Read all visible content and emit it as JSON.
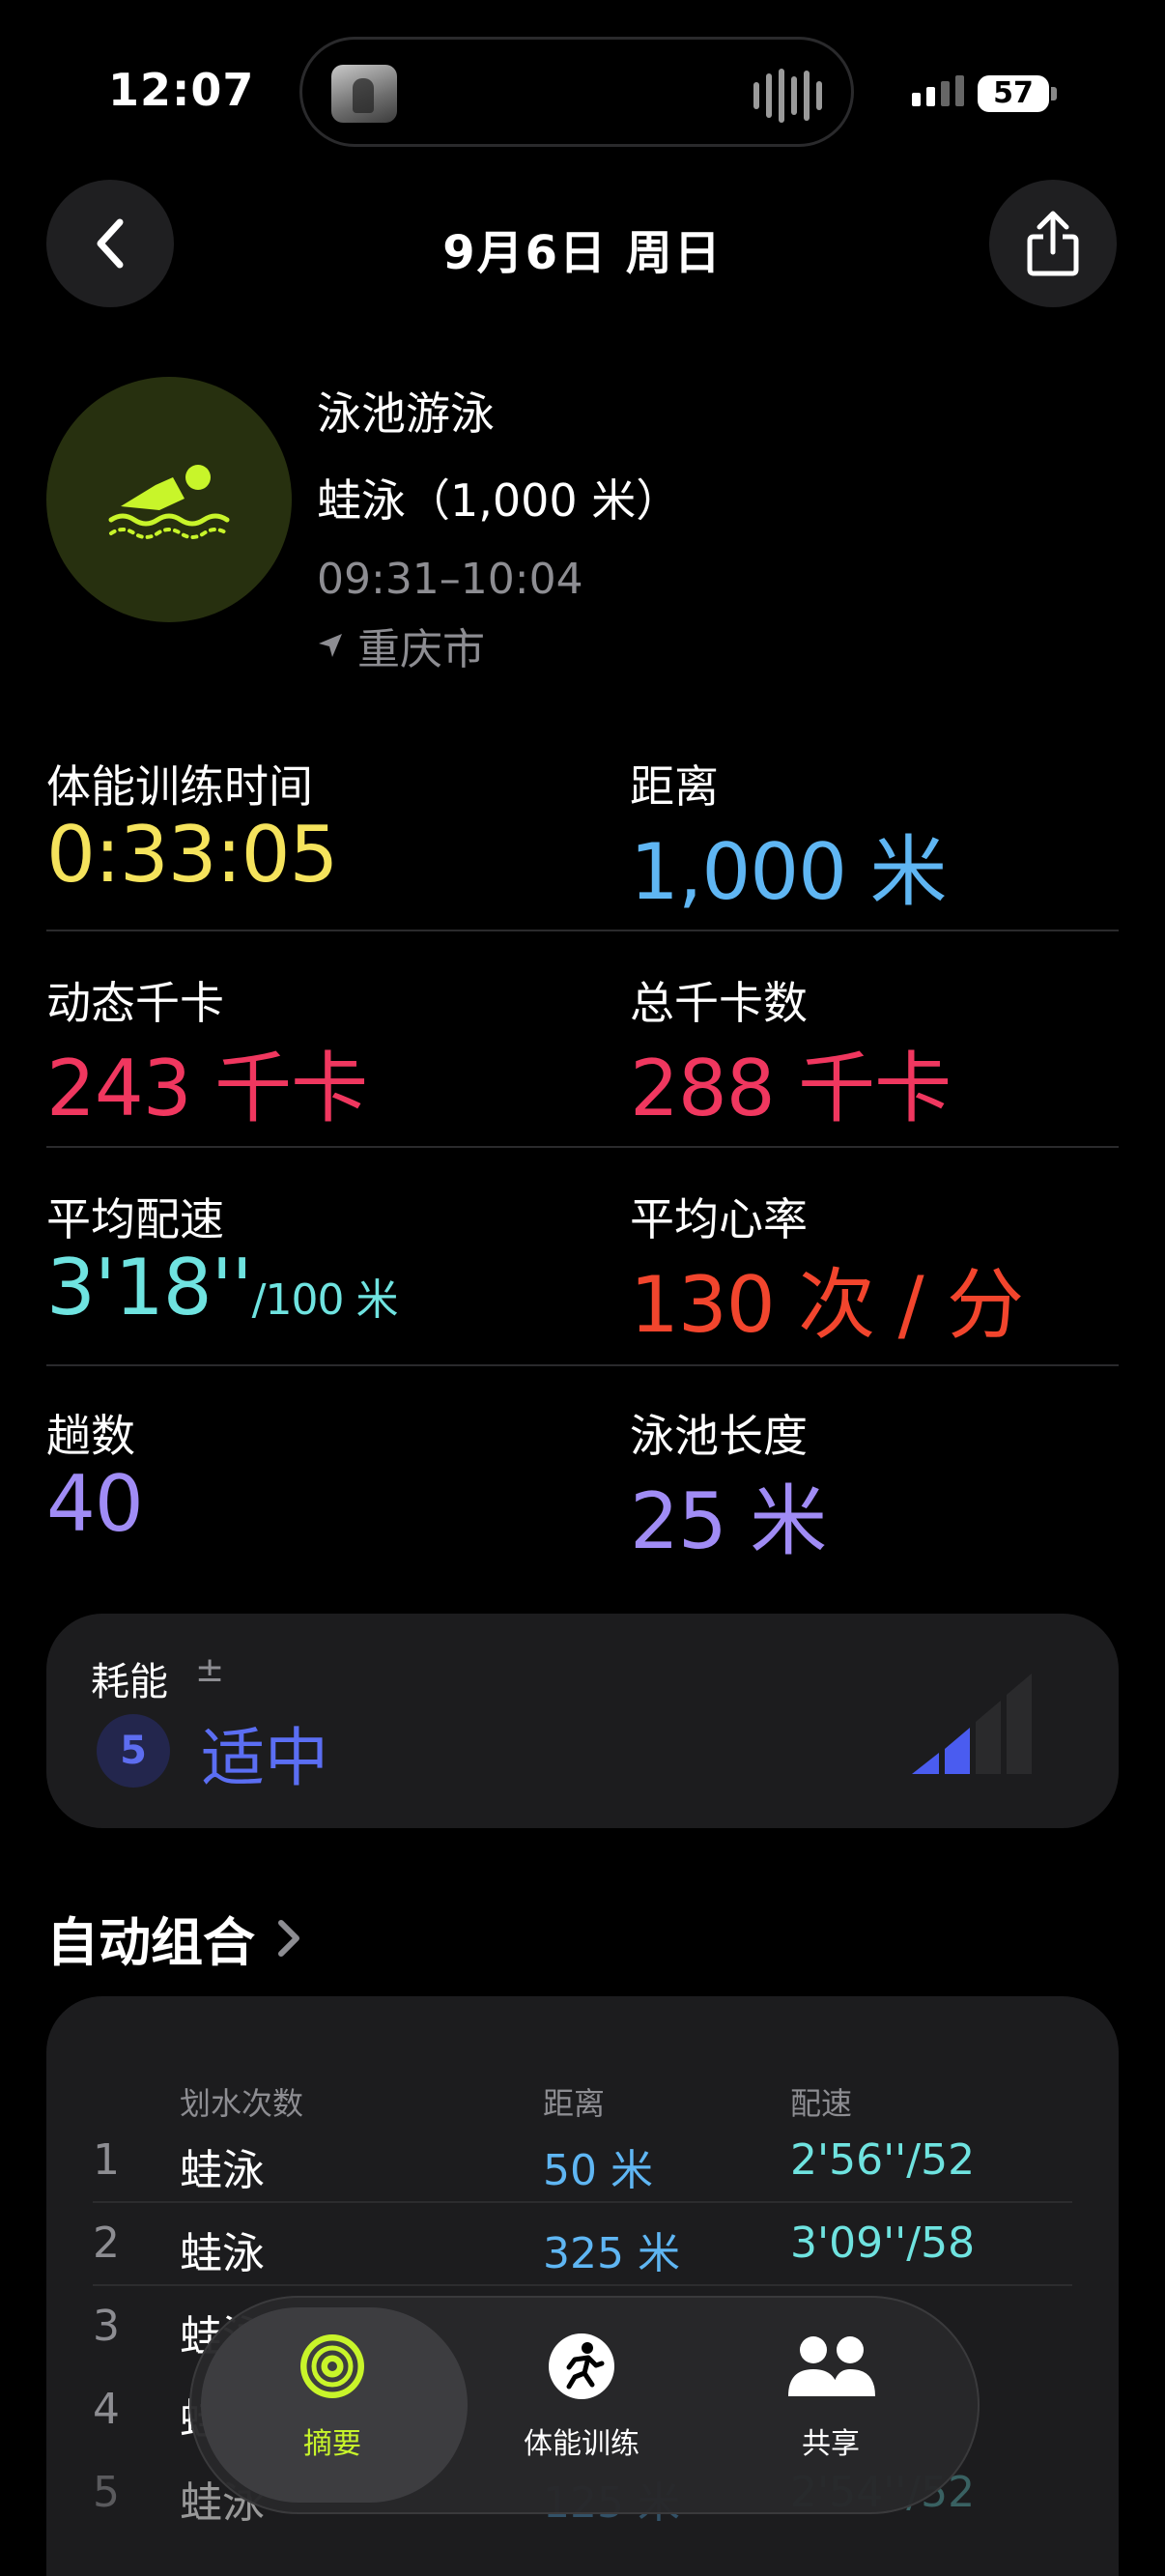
{
  "status": {
    "time": "12:07",
    "battery": "57"
  },
  "header": {
    "title": "9月6日 周日"
  },
  "workout": {
    "type": "泳池游泳",
    "subtitle": "蛙泳（1,000 米）",
    "time_range": "09:31–10:04",
    "location": "重庆市"
  },
  "metrics": [
    {
      "label": "体能训练时间",
      "value": "0:33:05",
      "unit": "",
      "color": "#f5e35c"
    },
    {
      "label": "距离",
      "value": "1,000",
      "unit": "米",
      "color": "#5fb6f3"
    },
    {
      "label": "动态千卡",
      "value": "243",
      "unit": "千卡",
      "color": "#f0375f"
    },
    {
      "label": "总千卡数",
      "value": "288",
      "unit": "千卡",
      "color": "#f0375f"
    },
    {
      "label": "平均配速",
      "value": "3'18''",
      "unit": "/100 米",
      "color": "#6fe3e0"
    },
    {
      "label": "平均心率",
      "value": "130",
      "unit": "次 / 分",
      "color": "#f2452d"
    },
    {
      "label": "趟数",
      "value": "40",
      "unit": "",
      "color": "#a08cf5"
    },
    {
      "label": "泳池长度",
      "value": "25",
      "unit": "米",
      "color": "#a08cf5"
    }
  ],
  "effort": {
    "label": "耗能",
    "plusminus": "±",
    "level": "5",
    "text": "适中",
    "color": "#5b6ef3"
  },
  "auto_sets": {
    "title": "自动组合",
    "headers": [
      "划水次数",
      "距离",
      "配速"
    ],
    "rows": [
      {
        "num": "1",
        "stroke": "蛙泳",
        "dist": "50 米",
        "pace": "2'56''/52"
      },
      {
        "num": "2",
        "stroke": "蛙泳",
        "dist": "325 米",
        "pace": "3'09''/58"
      },
      {
        "num": "3",
        "stroke": "蛙泳",
        "dist": "",
        "pace": ""
      },
      {
        "num": "4",
        "stroke": "蛙泳",
        "dist": "",
        "pace": ""
      },
      {
        "num": "5",
        "stroke": "蛙泳",
        "dist": "125 米",
        "pace": "2'54''/52"
      }
    ]
  },
  "tabbar": {
    "tabs": [
      {
        "label": "摘要",
        "color": "#c8f52a"
      },
      {
        "label": "体能训练",
        "color": "#ffffff"
      },
      {
        "label": "共享",
        "color": "#ffffff"
      }
    ]
  }
}
